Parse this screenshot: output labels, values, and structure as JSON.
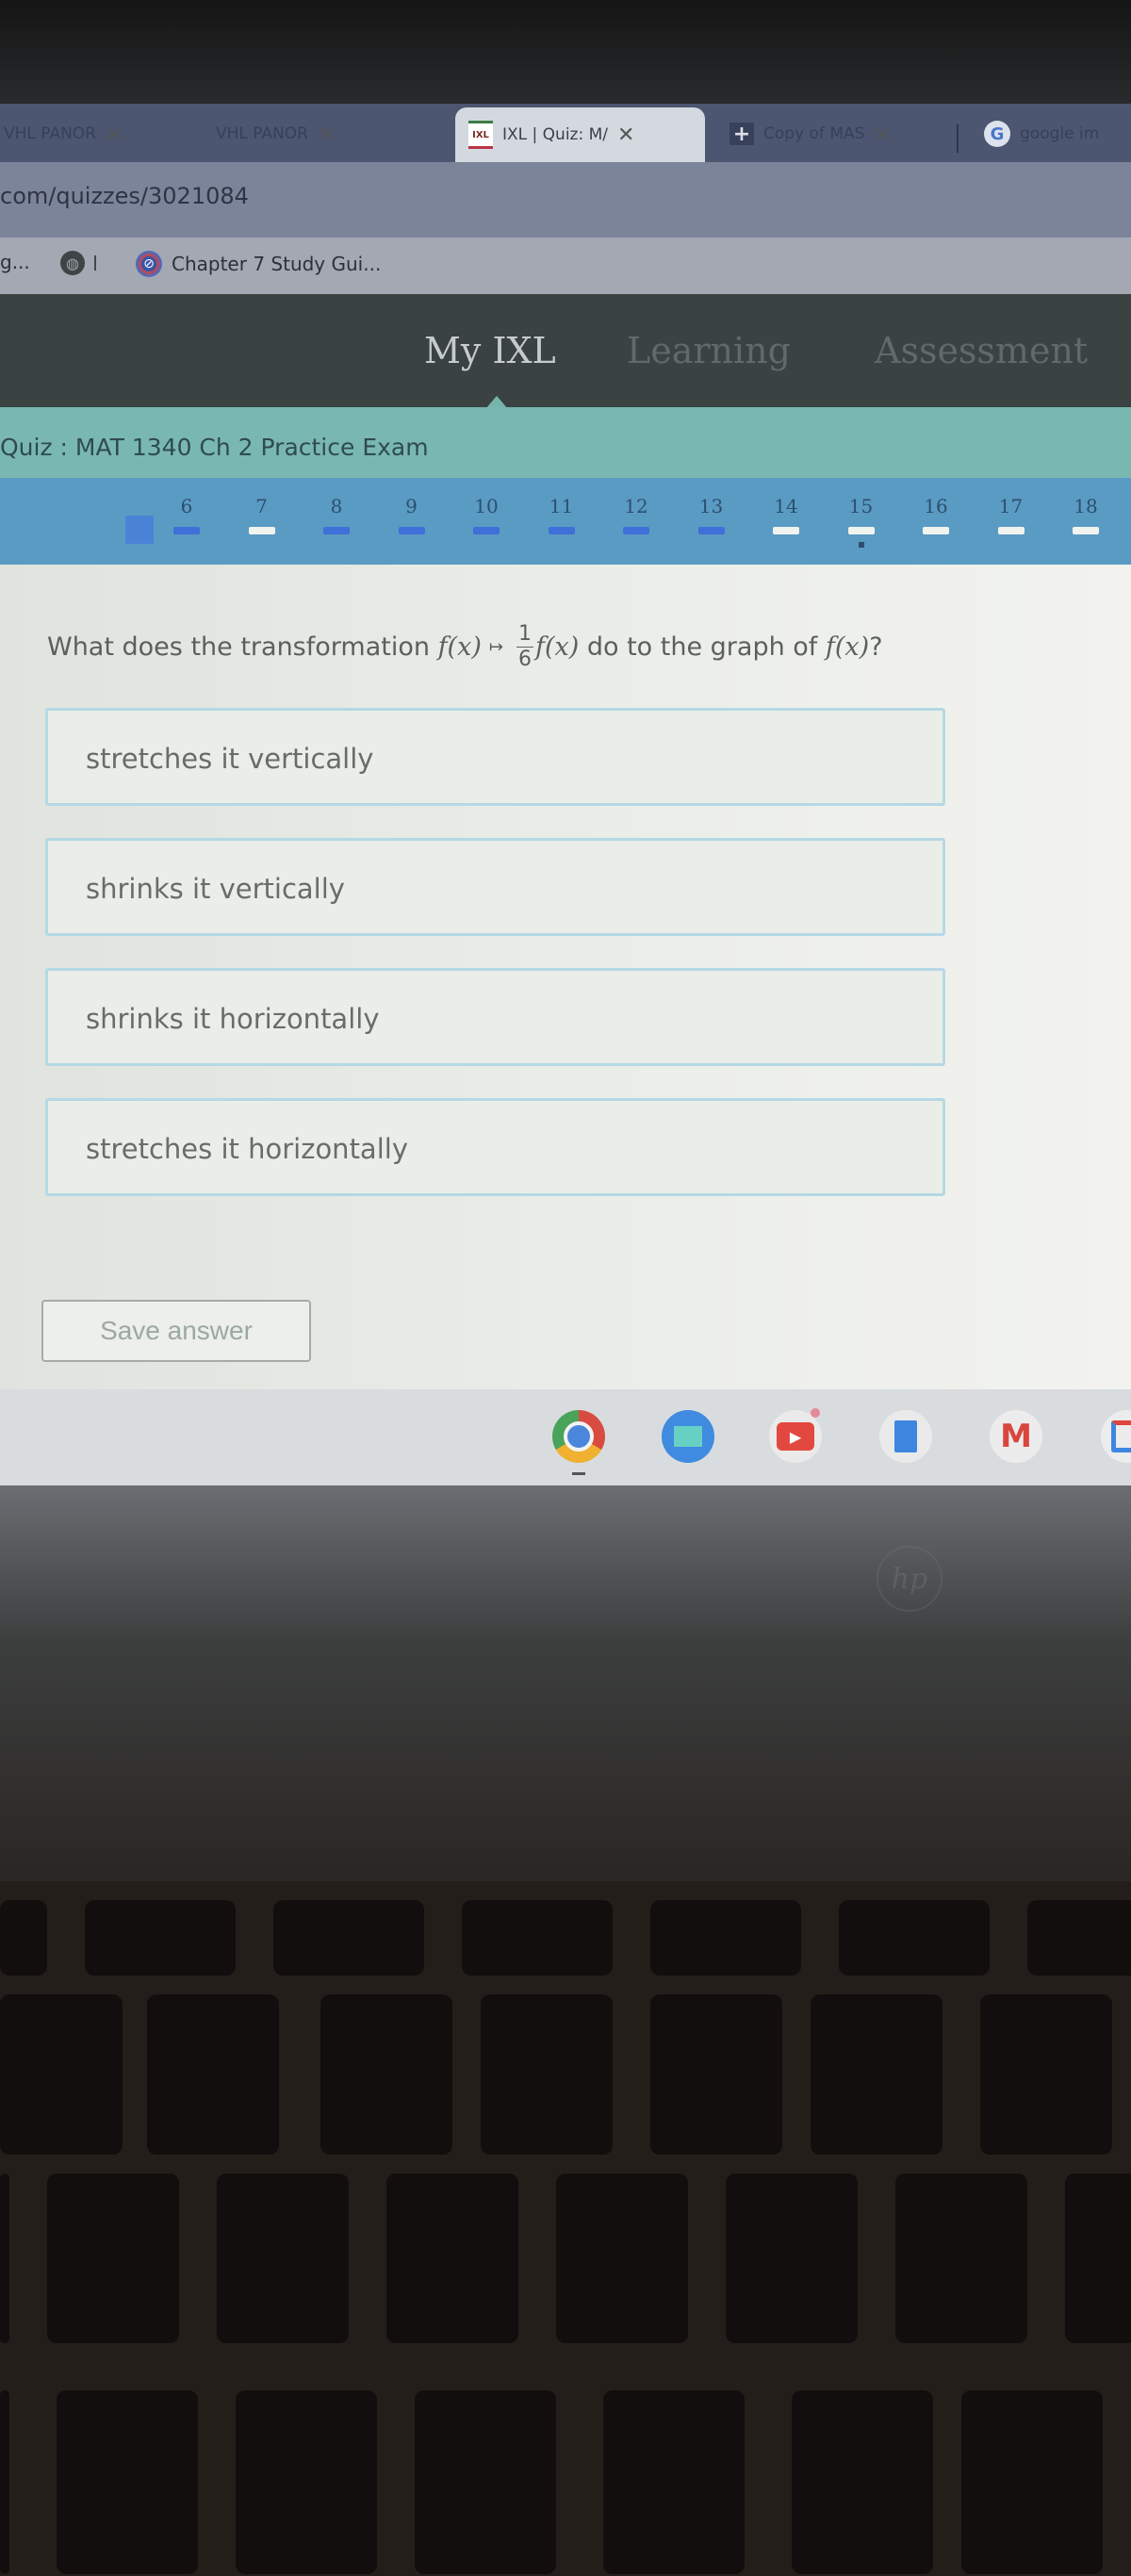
{
  "browser": {
    "tabs": [
      {
        "label": "VHL PANOR",
        "active": false,
        "icon": "vhl-icon"
      },
      {
        "label": "VHL PANOR",
        "active": false,
        "icon": "vhl-icon"
      },
      {
        "label": "IXL | Quiz: M/",
        "active": true,
        "icon": "ixl-icon"
      },
      {
        "label": "Copy of MAS",
        "active": false,
        "icon": "docs-plus-icon"
      },
      {
        "label": "google im",
        "active": false,
        "icon": "google-icon"
      }
    ],
    "tab_close_glyph": "×",
    "active_tab_close_glyph": "✕",
    "url": "com/quizzes/3021084",
    "bookmarks": [
      {
        "label": "g...",
        "icon": "bookmark-overflow"
      },
      {
        "label": "",
        "icon": "globe-icon"
      },
      {
        "label": "Chapter 7 Study Gui...",
        "icon": "compass-icon"
      }
    ]
  },
  "ixl": {
    "nav": [
      {
        "label": "My IXL",
        "active": true
      },
      {
        "label": "Learning",
        "active": false
      },
      {
        "label": "Assessment",
        "active": false
      }
    ],
    "quiz_title": "Quiz : MAT 1340 Ch 2 Practice Exam",
    "question_nav": [
      {
        "number": "6",
        "status": "answered"
      },
      {
        "number": "7",
        "status": "unanswered"
      },
      {
        "number": "8",
        "status": "answered"
      },
      {
        "number": "9",
        "status": "answered"
      },
      {
        "number": "10",
        "status": "answered"
      },
      {
        "number": "11",
        "status": "answered"
      },
      {
        "number": "12",
        "status": "answered"
      },
      {
        "number": "13",
        "status": "answered"
      },
      {
        "number": "14",
        "status": "unanswered"
      },
      {
        "number": "15",
        "status": "unanswered",
        "current": true
      },
      {
        "number": "16",
        "status": "unanswered"
      },
      {
        "number": "17",
        "status": "unanswered"
      },
      {
        "number": "18",
        "status": "unanswered"
      }
    ],
    "question": {
      "prefix": "What does the transformation",
      "fx": "f(x)",
      "maps_to": "↦",
      "frac_num": "1",
      "frac_den": "6",
      "fx2": "f(x)",
      "middle": "do to the graph of",
      "fx3": "f(x)",
      "suffix": "?"
    },
    "choices": [
      "stretches it vertically",
      "shrinks it vertically",
      "shrinks it horizontally",
      "stretches it horizontally"
    ],
    "save_button": "Save answer"
  },
  "shelf": {
    "apps": [
      "Chrome",
      "Files",
      "YouTube",
      "Docs",
      "Gmail",
      "Calendar"
    ]
  },
  "laptop": {
    "logo": "hp"
  },
  "colors": {
    "ixl_header": "#3a4342",
    "quiz_band": "#79b8b0",
    "question_nav": "#5a9bc4",
    "answered": "#3f6fd8",
    "unanswered": "#f1f3ee",
    "choice_border": "#b5d8e5"
  }
}
